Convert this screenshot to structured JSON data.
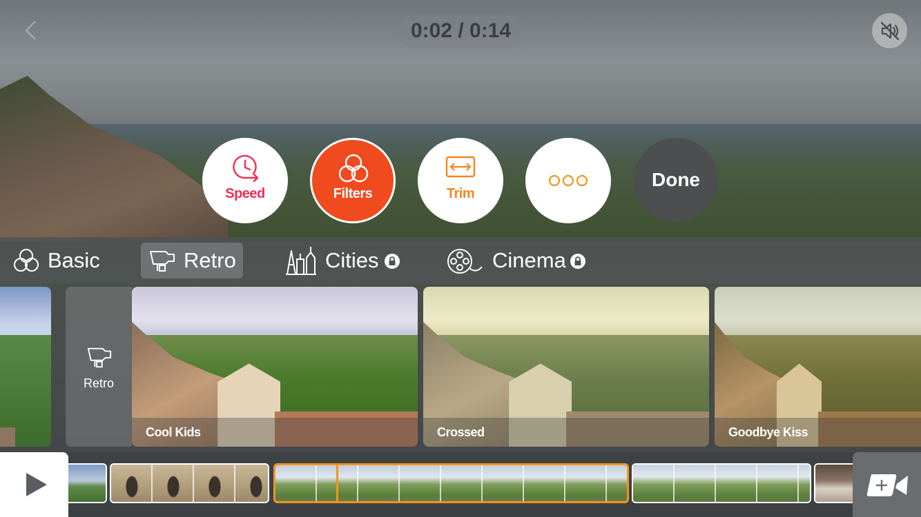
{
  "player": {
    "time_display": "0:02 / 0:14"
  },
  "actions": {
    "speed_label": "Speed",
    "filters_label": "Filters",
    "trim_label": "Trim",
    "done_label": "Done"
  },
  "categories": [
    {
      "label": "Basic",
      "locked": false
    },
    {
      "label": "Retro",
      "locked": false,
      "selected": true
    },
    {
      "label": "Cities",
      "locked": true
    },
    {
      "label": "Cinema",
      "locked": true
    }
  ],
  "filter_group_label": "Retro",
  "filters": [
    {
      "label": "Cool Kids"
    },
    {
      "label": "Crossed"
    },
    {
      "label": "Goodbye Kiss"
    }
  ],
  "colors": {
    "accent_red": "#f04a1f",
    "speed_pink": "#ee2f54",
    "trim_orange": "#f3861f",
    "selection_orange": "#f5941e"
  },
  "icons": {
    "back": "chevron-left-icon",
    "mute": "speaker-muted-icon",
    "speed": "clock-arrow-icon",
    "filters": "three-circles-icon",
    "trim": "trim-arrows-icon",
    "more": "three-dots-icon",
    "play": "play-icon",
    "add_clip": "add-video-icon",
    "lock": "lock-icon"
  }
}
